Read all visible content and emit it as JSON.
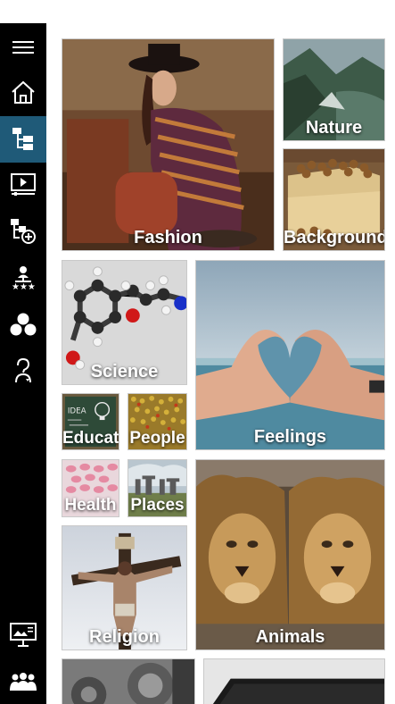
{
  "sidebar": {
    "items": [
      {
        "name": "menu-icon"
      },
      {
        "name": "home-icon"
      },
      {
        "name": "hierarchy-icon",
        "active": true
      },
      {
        "name": "slideshow-icon"
      },
      {
        "name": "add-category-icon"
      },
      {
        "name": "ranking-icon"
      },
      {
        "name": "three-circles-icon"
      },
      {
        "name": "help-user-icon"
      },
      {
        "name": "presentation-board-icon"
      },
      {
        "name": "group-icon"
      }
    ],
    "accent": "#1f5a78"
  },
  "tiles": {
    "fashion": "Fashion",
    "nature": "Nature",
    "backgrounds": "Backgrounds",
    "science": "Science",
    "feelings": "Feelings",
    "education": "Education",
    "people": "People",
    "health": "Health",
    "places": "Places",
    "religion": "Religion",
    "animals": "Animals"
  }
}
